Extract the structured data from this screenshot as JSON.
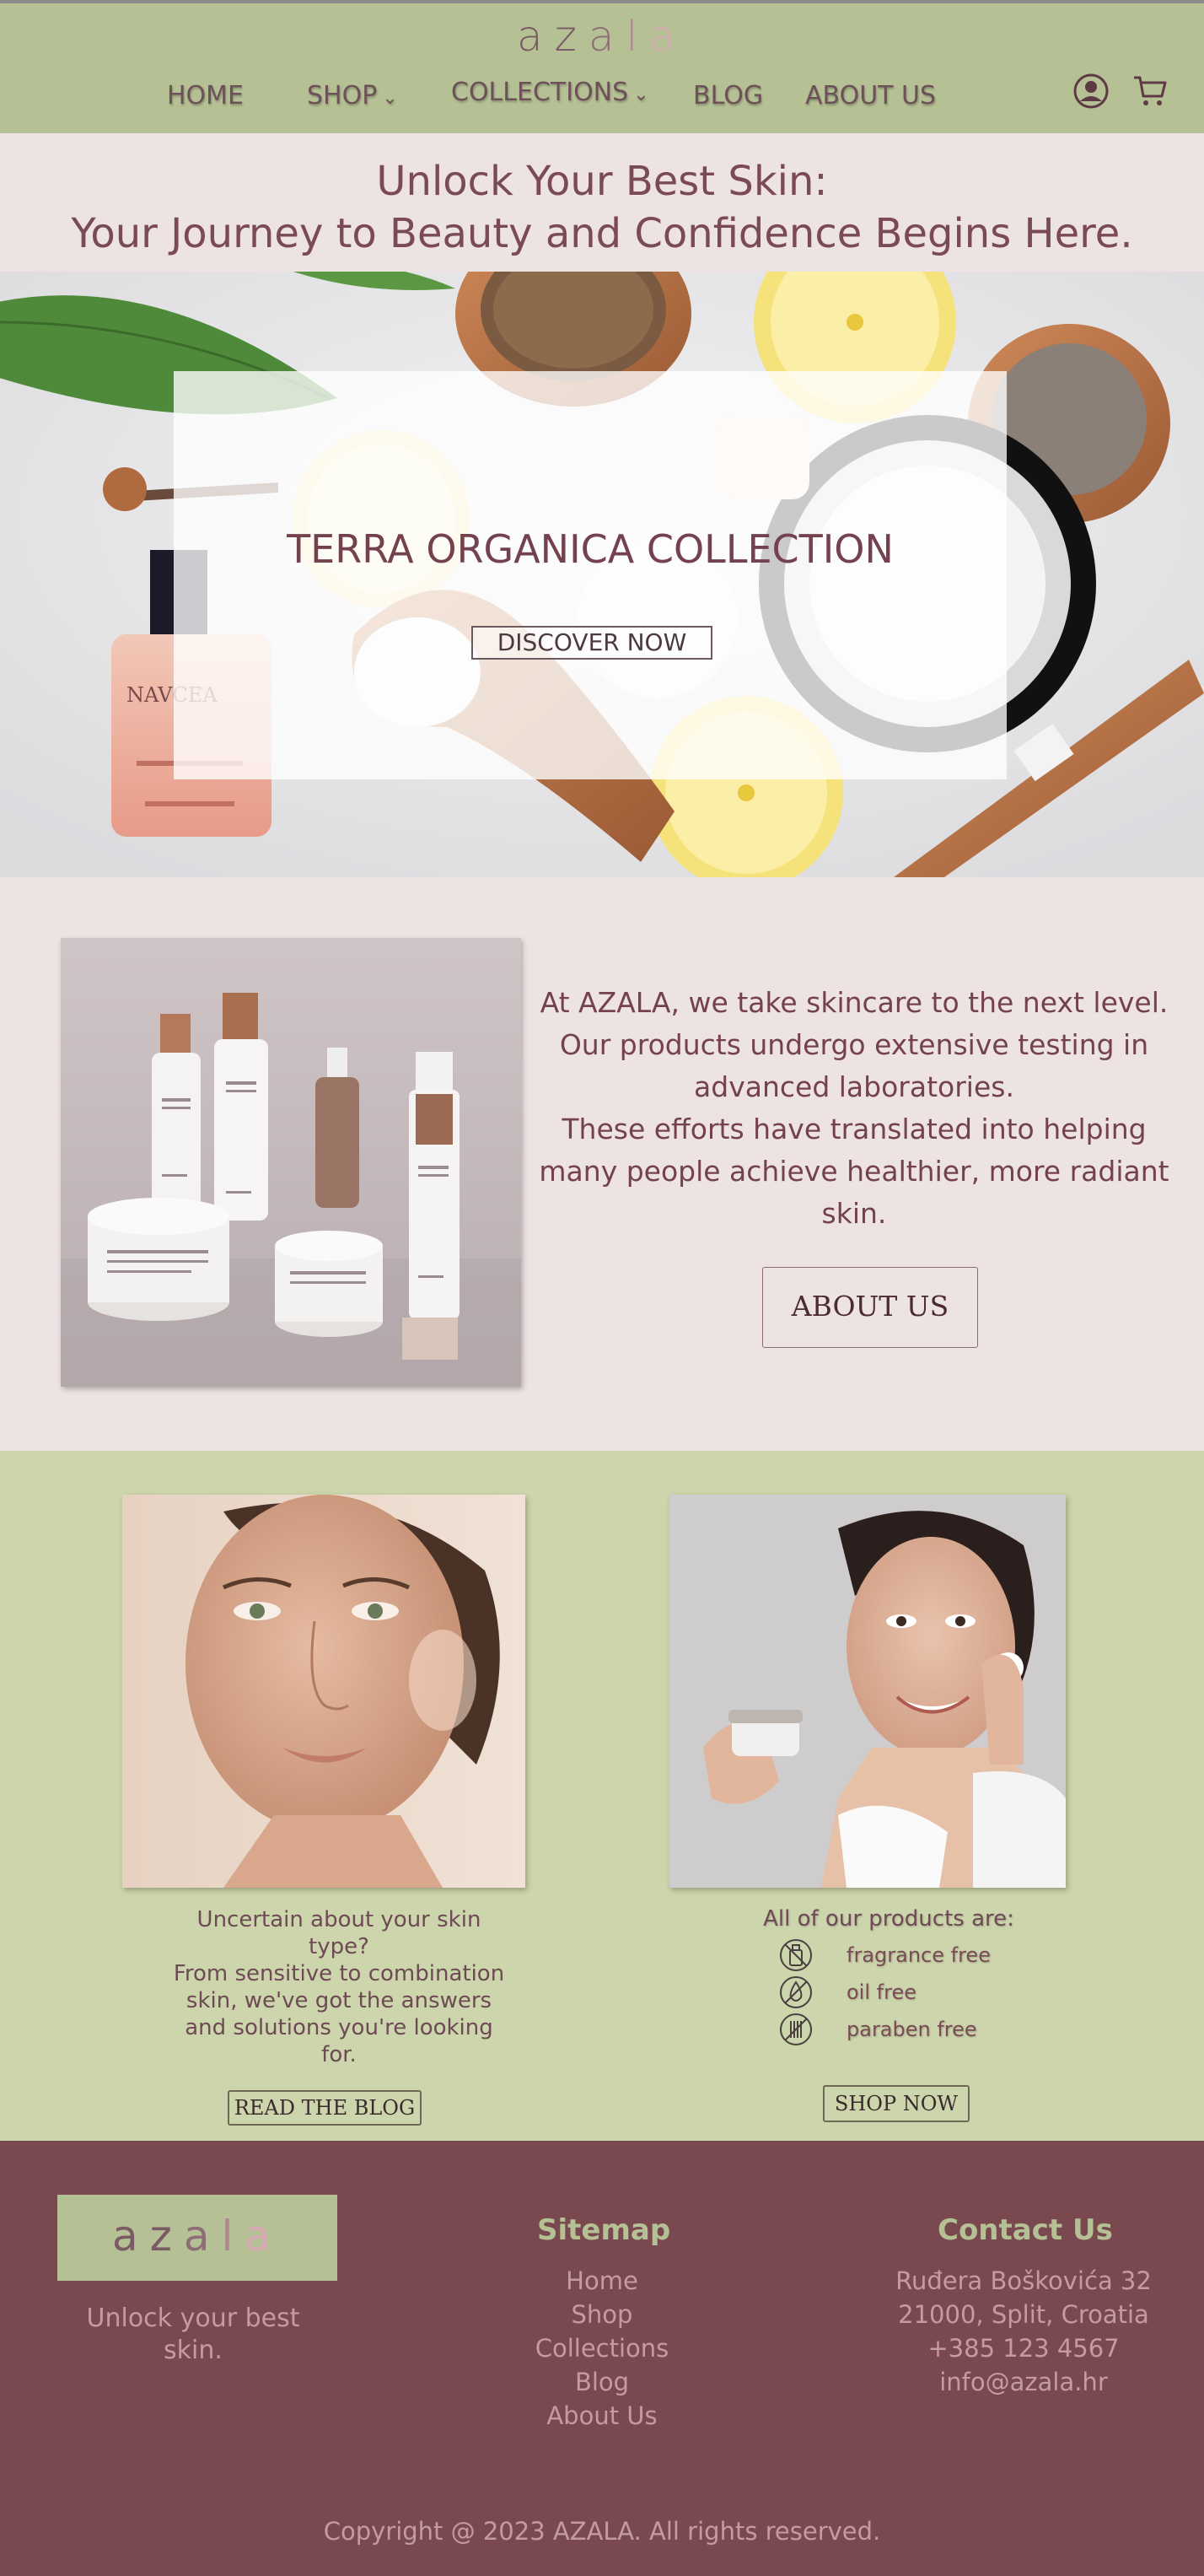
{
  "header": {
    "logo": {
      "l1": "a",
      "l2": "z",
      "l3": "a",
      "l4": "l",
      "l5": "a"
    },
    "nav": [
      {
        "label": "HOME"
      },
      {
        "label": "SHOP"
      },
      {
        "label": "COLLECTIONS"
      },
      {
        "label": "BLOG"
      },
      {
        "label": "ABOUT US"
      }
    ],
    "icons": {
      "account": "user-circle-icon",
      "cart": "shopping-cart-icon"
    }
  },
  "hero": {
    "line1": "Unlock Your Best Skin:",
    "line2": "Your Journey to Beauty and Confidence Begins Here."
  },
  "banner": {
    "title": "TERRA ORGANICA COLLECTION",
    "button": "DISCOVER NOW",
    "bottle_label": "NAVCEA"
  },
  "about": {
    "p1": "At AZALA, we take skincare to the next level.",
    "p2": "Our products undergo extensive testing in advanced laboratories.",
    "p3": "These efforts have translated into helping many people achieve healthier, more radiant skin.",
    "button": "ABOUT US"
  },
  "features": {
    "skin_text_1": "Uncertain about your skin type?",
    "skin_text_2": "From sensitive to combination skin, we've got the answers and solutions you're looking for.",
    "blog_button": "READ THE BLOG",
    "products_title": "All of our products are:",
    "properties": [
      {
        "label": "fragrance free",
        "icon": "no-fragrance-icon"
      },
      {
        "label": "oil free",
        "icon": "no-oil-icon"
      },
      {
        "label": "paraben free",
        "icon": "no-paraben-icon"
      }
    ],
    "shop_button": "SHOP NOW"
  },
  "footer": {
    "logo": {
      "l1": "a",
      "l2": "z",
      "l3": "a",
      "l4": "l",
      "l5": "a"
    },
    "tagline": "Unlock your best skin.",
    "sitemap_title": "Sitemap",
    "sitemap": [
      "Home",
      "Shop",
      "Collections",
      "Blog",
      "About Us"
    ],
    "contact_title": "Contact Us",
    "contact": [
      "Ruđera Boškovića 32",
      "21000, Split, Croatia",
      "+385 123 4567",
      "info@azala.hr"
    ],
    "copyright": "Copyright @ 2023 AZALA. All rights reserved."
  },
  "colors": {
    "header_green": "#b5c194",
    "section_green": "#ccd5ab",
    "blush_bg": "#ede3e3",
    "footer_plum": "#7a4950",
    "text_plum": "#74424f"
  }
}
